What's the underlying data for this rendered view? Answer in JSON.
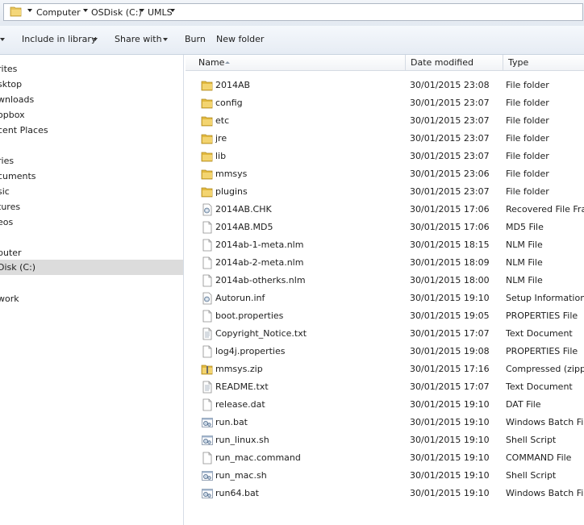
{
  "address": {
    "crumbs": [
      "Computer",
      "OSDisk (C:)",
      "UMLS"
    ]
  },
  "toolbar": {
    "include_in_library": "Include in library",
    "share_with": "Share with",
    "burn": "Burn",
    "new_folder": "New folder"
  },
  "nav": {
    "items": [
      {
        "label": "rites",
        "top": 0
      },
      {
        "label": "sktop"
      },
      {
        "label": "wnloads"
      },
      {
        "label": "opbox"
      },
      {
        "label": "cent Places"
      },
      {
        "label": "ries"
      },
      {
        "label": "cuments"
      },
      {
        "label": "sic"
      },
      {
        "label": "tures"
      },
      {
        "label": "eos"
      },
      {
        "label": "puter"
      },
      {
        "label": "Disk (C:)"
      },
      {
        "label": "work"
      }
    ]
  },
  "columns": {
    "name": "Name",
    "date": "Date modified",
    "type": "Type"
  },
  "files": [
    {
      "name": "2014AB",
      "date": "30/01/2015 23:08",
      "type": "File folder",
      "icon": "folder-icon"
    },
    {
      "name": "config",
      "date": "30/01/2015 23:07",
      "type": "File folder",
      "icon": "folder-icon"
    },
    {
      "name": "etc",
      "date": "30/01/2015 23:07",
      "type": "File folder",
      "icon": "folder-icon"
    },
    {
      "name": "jre",
      "date": "30/01/2015 23:07",
      "type": "File folder",
      "icon": "folder-icon"
    },
    {
      "name": "lib",
      "date": "30/01/2015 23:07",
      "type": "File folder",
      "icon": "folder-icon"
    },
    {
      "name": "mmsys",
      "date": "30/01/2015 23:06",
      "type": "File folder",
      "icon": "folder-icon"
    },
    {
      "name": "plugins",
      "date": "30/01/2015 23:07",
      "type": "File folder",
      "icon": "folder-icon"
    },
    {
      "name": "2014AB.CHK",
      "date": "30/01/2015 17:06",
      "type": "Recovered File Fragm",
      "icon": "gear-file-icon"
    },
    {
      "name": "2014AB.MD5",
      "date": "30/01/2015 17:06",
      "type": "MD5 File",
      "icon": "blank-file-icon"
    },
    {
      "name": "2014ab-1-meta.nlm",
      "date": "30/01/2015 18:15",
      "type": "NLM File",
      "icon": "blank-file-icon"
    },
    {
      "name": "2014ab-2-meta.nlm",
      "date": "30/01/2015 18:09",
      "type": "NLM File",
      "icon": "blank-file-icon"
    },
    {
      "name": "2014ab-otherks.nlm",
      "date": "30/01/2015 18:00",
      "type": "NLM File",
      "icon": "blank-file-icon"
    },
    {
      "name": "Autorun.inf",
      "date": "30/01/2015 19:10",
      "type": "Setup Information",
      "icon": "gear-file-icon"
    },
    {
      "name": "boot.properties",
      "date": "30/01/2015 19:05",
      "type": "PROPERTIES File",
      "icon": "blank-file-icon"
    },
    {
      "name": "Copyright_Notice.txt",
      "date": "30/01/2015 17:07",
      "type": "Text Document",
      "icon": "text-file-icon"
    },
    {
      "name": "log4j.properties",
      "date": "30/01/2015 19:08",
      "type": "PROPERTIES File",
      "icon": "blank-file-icon"
    },
    {
      "name": "mmsys.zip",
      "date": "30/01/2015 17:16",
      "type": "Compressed (zippe...",
      "icon": "zip-folder-icon"
    },
    {
      "name": "README.txt",
      "date": "30/01/2015 17:07",
      "type": "Text Document",
      "icon": "text-file-icon"
    },
    {
      "name": "release.dat",
      "date": "30/01/2015 19:10",
      "type": "DAT File",
      "icon": "blank-file-icon"
    },
    {
      "name": "run.bat",
      "date": "30/01/2015 19:10",
      "type": "Windows Batch File",
      "icon": "batch-file-icon"
    },
    {
      "name": "run_linux.sh",
      "date": "30/01/2015 19:10",
      "type": "Shell Script",
      "icon": "batch-file-icon"
    },
    {
      "name": "run_mac.command",
      "date": "30/01/2015 19:10",
      "type": "COMMAND File",
      "icon": "blank-file-icon"
    },
    {
      "name": "run_mac.sh",
      "date": "30/01/2015 19:10",
      "type": "Shell Script",
      "icon": "batch-file-icon"
    },
    {
      "name": "run64.bat",
      "date": "30/01/2015 19:10",
      "type": "Windows Batch File",
      "icon": "batch-file-icon"
    }
  ]
}
